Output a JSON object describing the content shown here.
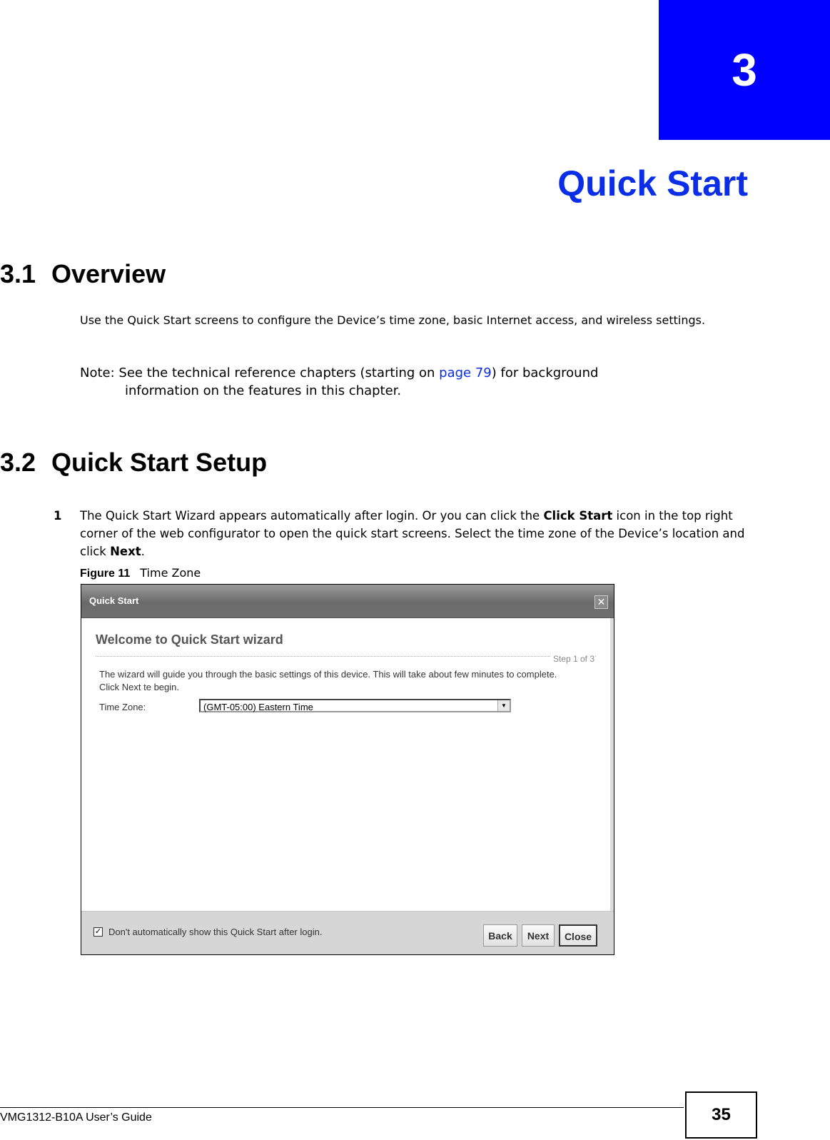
{
  "chapter": {
    "number": "3",
    "title": "Quick Start",
    "accent_color": "#0000ff"
  },
  "sections": [
    {
      "number": "3.1",
      "title": "Overview"
    },
    {
      "number": "3.2",
      "title": "Quick Start Setup"
    }
  ],
  "overview": {
    "text": "Use the Quick Start screens to configure the Device’s time zone, basic Internet access, and wireless settings.",
    "note_prefix": "Note: See the technical reference chapters (starting on ",
    "note_link": "page 79",
    "note_suffix": ") for background",
    "note_line2": "information on the features in this chapter."
  },
  "step1": {
    "number": "1",
    "text_a": "The Quick Start Wizard appears automatically after login. Or you can click the ",
    "bold_a": "Click Start",
    "text_b": " icon in the top right corner of the web configurator to open the quick start screens. Select the time zone of the Device’s location and click ",
    "bold_b": "Next",
    "text_c": "."
  },
  "figure": {
    "label": "Figure 11",
    "title": "Time Zone"
  },
  "dialog": {
    "title": "Quick Start",
    "close_icon": "close-icon",
    "heading": "Welcome to Quick Start wizard",
    "step_indicator": "Step 1 of 3",
    "description": "The wizard will guide you through the basic settings of this device. This will take about few minutes to complete. Click Next te begin.",
    "time_zone_label": "Time Zone:",
    "time_zone_value": "(GMT-05:00) Eastern Time",
    "checkbox_label": "Don't automatically show this Quick Start after login.",
    "checkbox_checked": true,
    "buttons": {
      "back": "Back",
      "next": "Next",
      "close": "Close"
    }
  },
  "footer": {
    "guide_title": "VMG1312-B10A User’s Guide",
    "page_number": "35"
  }
}
